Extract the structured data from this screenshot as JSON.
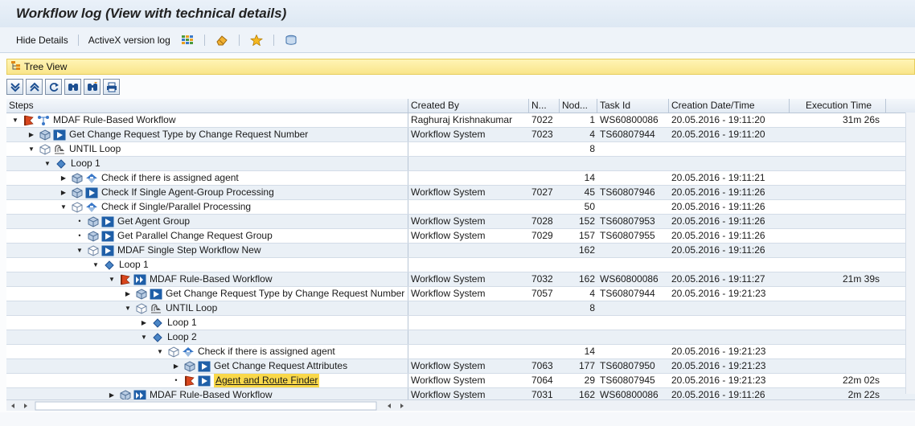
{
  "window": {
    "title": "Workflow log (View with technical details)"
  },
  "toolbar": {
    "hide_details": "Hide Details",
    "activex_log": "ActiveX version log",
    "icons": [
      "grid-icon",
      "eraser-icon",
      "favorite-star-icon",
      "database-icon"
    ]
  },
  "tree_view": {
    "label": "Tree View"
  },
  "tree_tools": [
    "expand-all-icon",
    "collapse-all-icon",
    "refresh-icon",
    "find-icon",
    "find-next-icon",
    "print-icon"
  ],
  "columns": {
    "steps": "Steps",
    "created_by": "Created By",
    "n": "N...",
    "node": "Nod...",
    "task_id": "Task Id",
    "creation_date": "Creation Date/Time",
    "execution_time": "Execution Time"
  },
  "rows": [
    {
      "level": 0,
      "toggle": "down",
      "icons": [
        "flag-icon",
        "workflow-icon"
      ],
      "step": "MDAF Rule-Based Workflow",
      "created_by": "Raghuraj Krishnakumar",
      "n": "7022",
      "node": "1",
      "task_id": "WS60800086",
      "date": "20.05.2016 - 19:11:20",
      "exec": "31m 26s"
    },
    {
      "level": 1,
      "toggle": "right",
      "icons": [
        "cube-icon",
        "play-icon"
      ],
      "step": "Get Change Request Type by Change Request Number",
      "created_by": "Workflow System",
      "n": "7023",
      "node": "4",
      "task_id": "TS60807944",
      "date": "20.05.2016 - 19:11:20",
      "exec": ""
    },
    {
      "level": 1,
      "toggle": "down",
      "icons": [
        "cube-outline-icon",
        "loop-icon"
      ],
      "step": "UNTIL Loop",
      "created_by": "",
      "n": "",
      "node": "8",
      "task_id": "",
      "date": "",
      "exec": ""
    },
    {
      "level": 2,
      "toggle": "down",
      "icons": [
        "diamond-icon"
      ],
      "step": "Loop 1",
      "created_by": "",
      "n": "",
      "node": "",
      "task_id": "",
      "date": "",
      "exec": ""
    },
    {
      "level": 3,
      "toggle": "right",
      "icons": [
        "cube-icon",
        "condition-icon"
      ],
      "step": "Check if there is assigned agent",
      "created_by": "",
      "n": "",
      "node": "14",
      "task_id": "",
      "date": "20.05.2016 - 19:11:21",
      "exec": ""
    },
    {
      "level": 3,
      "toggle": "right",
      "icons": [
        "cube-icon",
        "play-icon"
      ],
      "step": "Check If Single Agent-Group Processing",
      "created_by": "Workflow System",
      "n": "7027",
      "node": "45",
      "task_id": "TS60807946",
      "date": "20.05.2016 - 19:11:26",
      "exec": ""
    },
    {
      "level": 3,
      "toggle": "down",
      "icons": [
        "cube-outline-icon",
        "condition-icon"
      ],
      "step": "Check if Single/Parallel Processing",
      "created_by": "",
      "n": "",
      "node": "50",
      "task_id": "",
      "date": "20.05.2016 - 19:11:26",
      "exec": ""
    },
    {
      "level": 4,
      "toggle": "dot",
      "icons": [
        "cube-icon",
        "play-icon"
      ],
      "step": "Get Agent Group",
      "created_by": "Workflow System",
      "n": "7028",
      "node": "152",
      "task_id": "TS60807953",
      "date": "20.05.2016 - 19:11:26",
      "exec": ""
    },
    {
      "level": 4,
      "toggle": "dot",
      "icons": [
        "cube-icon",
        "play-icon"
      ],
      "step": "Get Parallel Change Request Group",
      "created_by": "Workflow System",
      "n": "7029",
      "node": "157",
      "task_id": "TS60807955",
      "date": "20.05.2016 - 19:11:26",
      "exec": ""
    },
    {
      "level": 4,
      "toggle": "down",
      "icons": [
        "cube-outline-icon",
        "play-icon"
      ],
      "step": "MDAF Single Step Workflow New",
      "created_by": "",
      "n": "",
      "node": "162",
      "task_id": "",
      "date": "20.05.2016 - 19:11:26",
      "exec": ""
    },
    {
      "level": 5,
      "toggle": "down",
      "icons": [
        "diamond-icon"
      ],
      "step": "Loop 1",
      "created_by": "",
      "n": "",
      "node": "",
      "task_id": "",
      "date": "",
      "exec": ""
    },
    {
      "level": 6,
      "toggle": "down",
      "icons": [
        "flag-icon",
        "subworkflow-icon"
      ],
      "step": "MDAF Rule-Based Workflow",
      "created_by": "Workflow System",
      "n": "7032",
      "node": "162",
      "task_id": "WS60800086",
      "date": "20.05.2016 - 19:11:27",
      "exec": "21m 39s"
    },
    {
      "level": 7,
      "toggle": "right",
      "icons": [
        "cube-icon",
        "play-icon"
      ],
      "step": "Get Change Request Type by Change Request Number",
      "created_by": "Workflow System",
      "n": "7057",
      "node": "4",
      "task_id": "TS60807944",
      "date": "20.05.2016 - 19:21:23",
      "exec": ""
    },
    {
      "level": 7,
      "toggle": "down",
      "icons": [
        "cube-outline-icon",
        "loop-icon"
      ],
      "step": "UNTIL Loop",
      "created_by": "",
      "n": "",
      "node": "8",
      "task_id": "",
      "date": "",
      "exec": ""
    },
    {
      "level": 8,
      "toggle": "right",
      "icons": [
        "diamond-icon"
      ],
      "step": "Loop 1",
      "created_by": "",
      "n": "",
      "node": "",
      "task_id": "",
      "date": "",
      "exec": ""
    },
    {
      "level": 8,
      "toggle": "down",
      "icons": [
        "diamond-icon"
      ],
      "step": "Loop 2",
      "created_by": "",
      "n": "",
      "node": "",
      "task_id": "",
      "date": "",
      "exec": ""
    },
    {
      "level": 9,
      "toggle": "down",
      "icons": [
        "cube-outline-icon",
        "condition-icon"
      ],
      "step": "Check if there is assigned agent",
      "created_by": "",
      "n": "",
      "node": "14",
      "task_id": "",
      "date": "20.05.2016 - 19:21:23",
      "exec": ""
    },
    {
      "level": 10,
      "toggle": "right",
      "icons": [
        "cube-icon",
        "play-icon"
      ],
      "step": "Get Change Request Attributes",
      "created_by": "Workflow System",
      "n": "7063",
      "node": "177",
      "task_id": "TS60807950",
      "date": "20.05.2016 - 19:21:23",
      "exec": ""
    },
    {
      "level": 10,
      "toggle": "dot",
      "icons": [
        "flag-icon",
        "play-icon"
      ],
      "step": "Agent and Route Finder",
      "highlight": true,
      "created_by": "Workflow System",
      "n": "7064",
      "node": "29",
      "task_id": "TS60807945",
      "date": "20.05.2016 - 19:21:23",
      "exec": "22m 02s"
    },
    {
      "level": 6,
      "toggle": "right",
      "icons": [
        "cube-icon",
        "subworkflow-icon"
      ],
      "step": "MDAF Rule-Based Workflow",
      "created_by": "Workflow System",
      "n": "7031",
      "node": "162",
      "task_id": "WS60800086",
      "date": "20.05.2016 - 19:11:26",
      "exec": "2m 22s"
    }
  ],
  "colors": {
    "title_bg": "#dde8f3",
    "tree_view_bar": "#f9e58a",
    "highlight": "#f9d84a",
    "row_alt": "#eaf0f6"
  }
}
